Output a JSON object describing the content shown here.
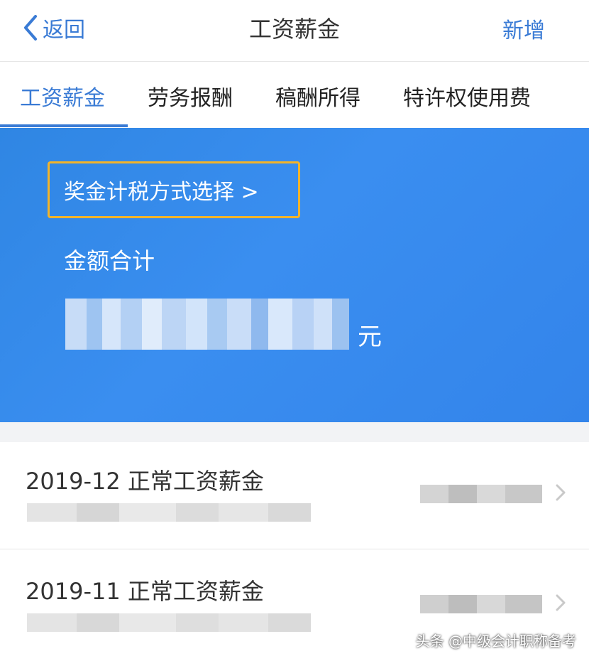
{
  "navbar": {
    "back_label": "返回",
    "title": "工资薪金",
    "add_label": "新增"
  },
  "tabs": [
    {
      "label": "工资薪金",
      "active": true
    },
    {
      "label": "劳务报酬",
      "active": false
    },
    {
      "label": "稿酬所得",
      "active": false
    },
    {
      "label": "特许权使用费",
      "active": false
    }
  ],
  "summary": {
    "bonus_method_label": "奖金计税方式选择 >",
    "total_label": "金额合计",
    "amount_unit": "元"
  },
  "records": [
    {
      "title": "2019-12 正常工资薪金"
    },
    {
      "title": "2019-11 正常工资薪金"
    }
  ],
  "watermark": "头条 @中级会计职称备考",
  "colors": {
    "accent": "#3a7bd5",
    "banner": "#3a8ef0",
    "highlight_border": "#f3b429"
  }
}
